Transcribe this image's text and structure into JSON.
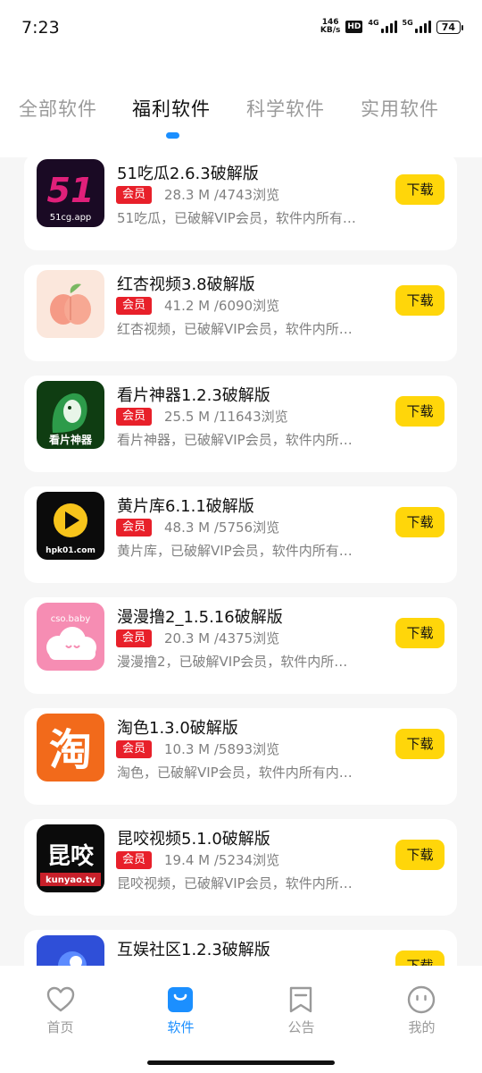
{
  "status_bar": {
    "time": "7:23",
    "speed_value": "146",
    "speed_unit": "KB/s",
    "hd": "HD",
    "net1": "4G",
    "net2": "5G",
    "battery": "74"
  },
  "tabs": [
    {
      "label": "全部软件",
      "active": false
    },
    {
      "label": "福利软件",
      "active": true
    },
    {
      "label": "科学软件",
      "active": false
    },
    {
      "label": "实用软件",
      "active": false
    }
  ],
  "badge_label": "会员",
  "download_label": "下载",
  "apps": [
    {
      "title": "51吃瓜2.6.3破解版",
      "meta": "28.3 M /4743浏览",
      "desc": "51吃瓜，已破解VIP会员，软件内所有…",
      "icon": "chigua-51-icon",
      "icon_text": "51cg.app"
    },
    {
      "title": "红杏视频3.8破解版",
      "meta": "41.2 M /6090浏览",
      "desc": "红杏视频，已破解VIP会员，软件内所…",
      "icon": "peach-icon"
    },
    {
      "title": "看片神器1.2.3破解版",
      "meta": "25.5 M /11643浏览",
      "desc": "看片神器，已破解VIP会员，软件内所…",
      "icon": "kanpian-icon",
      "icon_text": "看片神器"
    },
    {
      "title": "黄片库6.1.1破解版",
      "meta": "48.3 M /5756浏览",
      "desc": "黄片库，已破解VIP会员，软件内所有…",
      "icon": "play-icon",
      "icon_text": "hpk01.com"
    },
    {
      "title": "漫漫撸2_1.5.16破解版",
      "meta": "20.3 M /4375浏览",
      "desc": "漫漫撸2，已破解VIP会员，软件内所…",
      "icon": "cloud-icon",
      "icon_text": "cso.baby"
    },
    {
      "title": "淘色1.3.0破解版",
      "meta": "10.3 M /5893浏览",
      "desc": "淘色，已破解VIP会员，软件内所有内…",
      "icon": "tao-icon",
      "icon_text": "淘"
    },
    {
      "title": "昆咬视频5.1.0破解版",
      "meta": "19.4 M /5234浏览",
      "desc": "昆咬视频，已破解VIP会员，软件内所…",
      "icon": "kunyao-icon",
      "icon_text": "昆咬",
      "icon_subtext": "kunyao.tv"
    },
    {
      "title": "互娱社区1.2.3破解版",
      "meta": "",
      "desc": "",
      "icon": "huyu-icon"
    }
  ],
  "bottom_nav": [
    {
      "label": "首页",
      "icon": "heart-icon",
      "active": false
    },
    {
      "label": "软件",
      "icon": "bag-icon",
      "active": true
    },
    {
      "label": "公告",
      "icon": "bookmark-icon",
      "active": false
    },
    {
      "label": "我的",
      "icon": "smiley-icon",
      "active": false
    }
  ],
  "colors": {
    "accent": "#1b8fff",
    "download": "#ffd60a",
    "badge": "#e8202a"
  }
}
